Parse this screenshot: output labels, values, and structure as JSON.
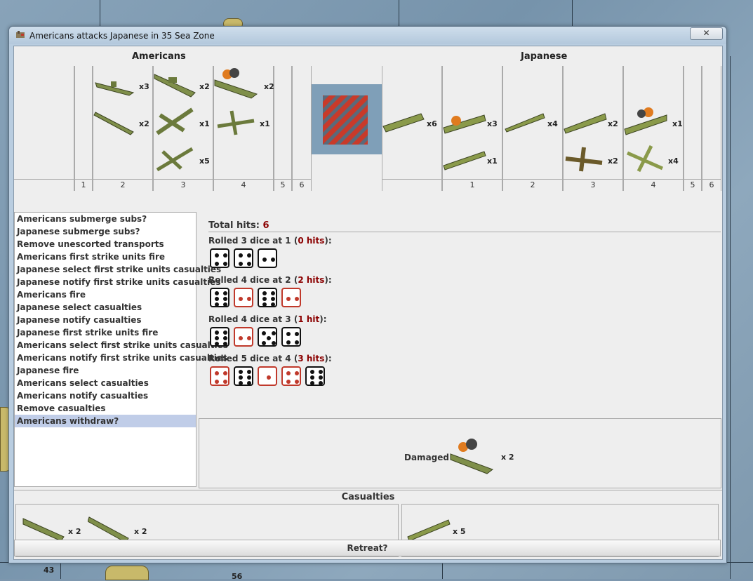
{
  "window": {
    "title": "Americans attacks Japanese in 35 Sea Zone",
    "close_label": "✕"
  },
  "map": {
    "labels": [
      "43",
      "56"
    ]
  },
  "americans": {
    "name": "Americans",
    "columns": [
      "",
      "1",
      "2",
      "3",
      "4",
      "5",
      "6"
    ],
    "units": [
      {
        "icon": "destroyer-icon",
        "count": "x3"
      },
      {
        "icon": "submarine-icon",
        "count": "x2"
      },
      {
        "icon": "cruiser-icon",
        "count": "x2"
      },
      {
        "icon": "bomber-icon",
        "count": "x1"
      },
      {
        "icon": "fighter-icon",
        "count": "x5"
      },
      {
        "icon": "damaged-battleship-icon",
        "count": "x2"
      },
      {
        "icon": "fighter-icon",
        "count": "x1"
      }
    ]
  },
  "japanese": {
    "name": "Japanese",
    "columns": [
      "",
      "1",
      "2",
      "3",
      "4",
      "5",
      "6"
    ],
    "units": [
      {
        "icon": "transport-icon",
        "count": "x6"
      },
      {
        "icon": "damaged-carrier-icon",
        "count": "x3"
      },
      {
        "icon": "submarine-icon",
        "count": "x1"
      },
      {
        "icon": "destroyer-icon",
        "count": "x4"
      },
      {
        "icon": "cruiser-icon",
        "count": "x2"
      },
      {
        "icon": "fighter-icon",
        "count": "x2"
      },
      {
        "icon": "damaged-battleship-icon",
        "count": "x1"
      },
      {
        "icon": "fighter-icon",
        "count": "x4"
      }
    ]
  },
  "steps": [
    "Americans submerge subs?",
    "Japanese submerge subs?",
    "Remove unescorted transports",
    "Americans first strike units fire",
    "Japanese select first strike units casualties",
    "Japanese notify first strike units casualties",
    "Americans fire",
    "Japanese select casualties",
    "Japanese notify casualties",
    "Japanese first strike units fire",
    "Americans select first strike units casualties",
    "Americans notify first strike units casualties",
    "Japanese fire",
    "Americans select casualties",
    "Americans notify casualties",
    "Remove casualties",
    "Americans withdraw?"
  ],
  "selected_step": 16,
  "dice": {
    "total_label": "Total hits:",
    "total_value": "6",
    "rolls": [
      {
        "prefix": "Rolled 3 dice at 1 (",
        "hits": "0 hits",
        "suffix": "):",
        "dice": [
          4,
          4,
          2
        ],
        "hit": [
          false,
          false,
          false
        ]
      },
      {
        "prefix": "Rolled 4 dice at 2 (",
        "hits": "2 hits",
        "suffix": "):",
        "dice": [
          6,
          2,
          6,
          2
        ],
        "hit": [
          false,
          true,
          false,
          true
        ]
      },
      {
        "prefix": "Rolled 4 dice at 3 (",
        "hits": "1 hit",
        "suffix": "):",
        "dice": [
          6,
          2,
          5,
          4
        ],
        "hit": [
          false,
          true,
          false,
          false
        ]
      },
      {
        "prefix": "Rolled 5 dice at 4 (",
        "hits": "3 hits",
        "suffix": "):",
        "dice": [
          4,
          6,
          1,
          4,
          6
        ],
        "hit": [
          true,
          false,
          true,
          true,
          false
        ]
      }
    ]
  },
  "damaged": {
    "label": "Damaged",
    "icon": "damaged-battleship-icon",
    "count": "x 2"
  },
  "casualties": {
    "title": "Casualties",
    "american": [
      {
        "icon": "submarine-icon",
        "count": "x 2"
      },
      {
        "icon": "submarine-icon",
        "count": "x 2"
      }
    ],
    "japanese": [
      {
        "icon": "submarine-icon",
        "count": "x 5"
      }
    ]
  },
  "retreat_label": "Retreat?",
  "colors": {
    "hit": "#c0392b",
    "total": "#8b0000",
    "unit": "#7f8f4a",
    "selected": "#c0cde8"
  }
}
